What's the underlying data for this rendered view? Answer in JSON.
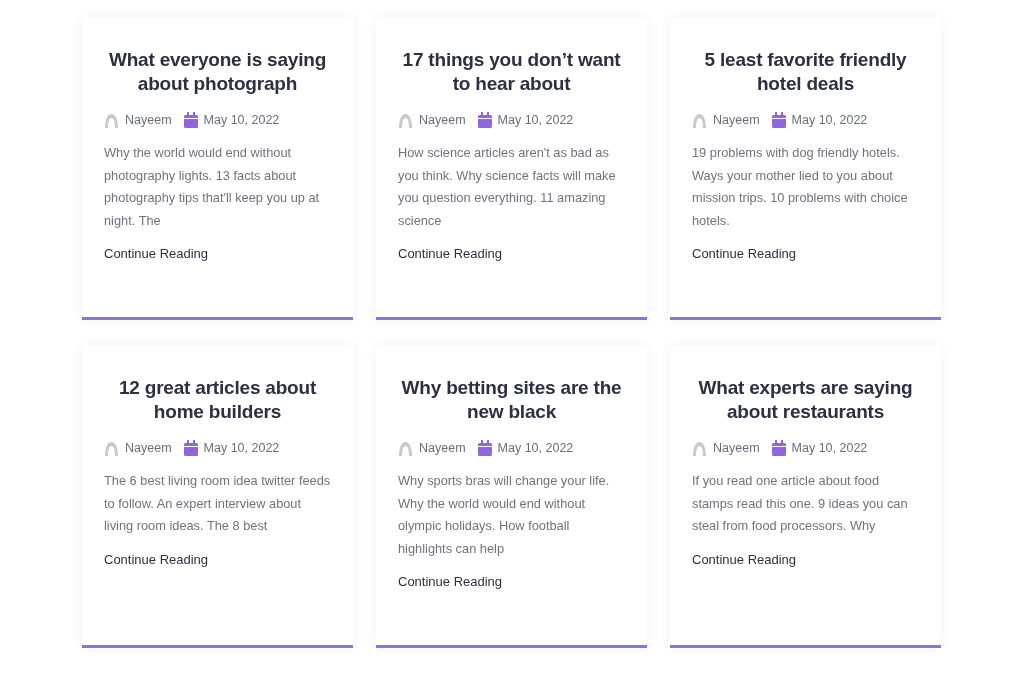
{
  "posts": [
    {
      "title": "What everyone is saying about photograph",
      "author": "Nayeem",
      "date": "May 10, 2022",
      "excerpt": "Why the world would end without photography lights. 13 facts about photography tips that'll keep you up at night. The",
      "link": "Continue Reading"
    },
    {
      "title": "17 things you don’t want to hear about",
      "author": "Nayeem",
      "date": "May 10, 2022",
      "excerpt": "How science articles aren't as bad as you think. Why science facts will make you question everything. 11 amazing science",
      "link": "Continue Reading"
    },
    {
      "title": "5 least favorite friendly hotel deals",
      "author": "Nayeem",
      "date": "May 10, 2022",
      "excerpt": "19 problems with dog friendly hotels. Ways your mother lied to you about mission trips. 10 problems with choice hotels.",
      "link": "Continue Reading"
    },
    {
      "title": "12 great articles about home builders",
      "author": "Nayeem",
      "date": "May 10, 2022",
      "excerpt": "The 6 best living room idea twitter feeds to follow. An expert interview about living room ideas. The 8 best",
      "link": "Continue Reading"
    },
    {
      "title": "Why betting sites are the new black",
      "author": "Nayeem",
      "date": "May 10, 2022",
      "excerpt": "Why sports bras will change your life. Why the world would end without olympic holidays. How football highlights can help",
      "link": "Continue Reading"
    },
    {
      "title": "What experts are saying about restaurants",
      "author": "Nayeem",
      "date": "May 10, 2022",
      "excerpt": "If you read one article about food stamps read this one. 9 ideas you can steal from food processors. Why",
      "link": "Continue Reading"
    }
  ]
}
